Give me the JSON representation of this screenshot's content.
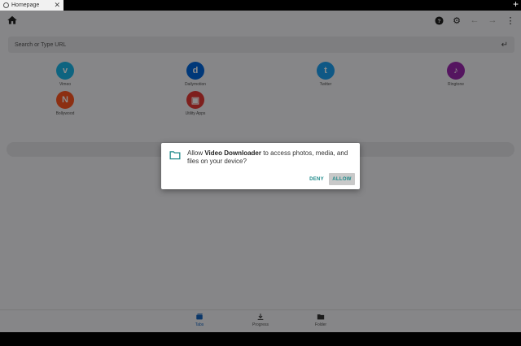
{
  "tab": {
    "title": "Homepage"
  },
  "urlbar": {
    "placeholder": "Search or Type URL"
  },
  "shortcuts": [
    {
      "label": "Vimeo",
      "glyph": "v",
      "color": "#1ab7ea"
    },
    {
      "label": "Dailymotion",
      "glyph": "d",
      "color": "#0066dc"
    },
    {
      "label": "Twitter",
      "glyph": "t",
      "color": "#1da1f2"
    },
    {
      "label": "Ringtone",
      "glyph": "♪",
      "color": "#9c27b0"
    },
    {
      "label": "Bollywood",
      "glyph": "N",
      "color": "#ff5722"
    },
    {
      "label": "Utility Apps",
      "glyph": "▣",
      "color": "#e53935"
    }
  ],
  "bottom_nav": [
    {
      "label": "Tabs"
    },
    {
      "label": "Progress"
    },
    {
      "label": "Folder"
    }
  ],
  "dialog": {
    "text_prefix": "Allow ",
    "app_name": "Video Downloader",
    "text_suffix": " to access photos, media, and files on your device?",
    "deny_label": "DENY",
    "allow_label": "ALLOW"
  },
  "colors": {
    "accent": "#1f8a8a",
    "active_nav": "#1565c0"
  }
}
